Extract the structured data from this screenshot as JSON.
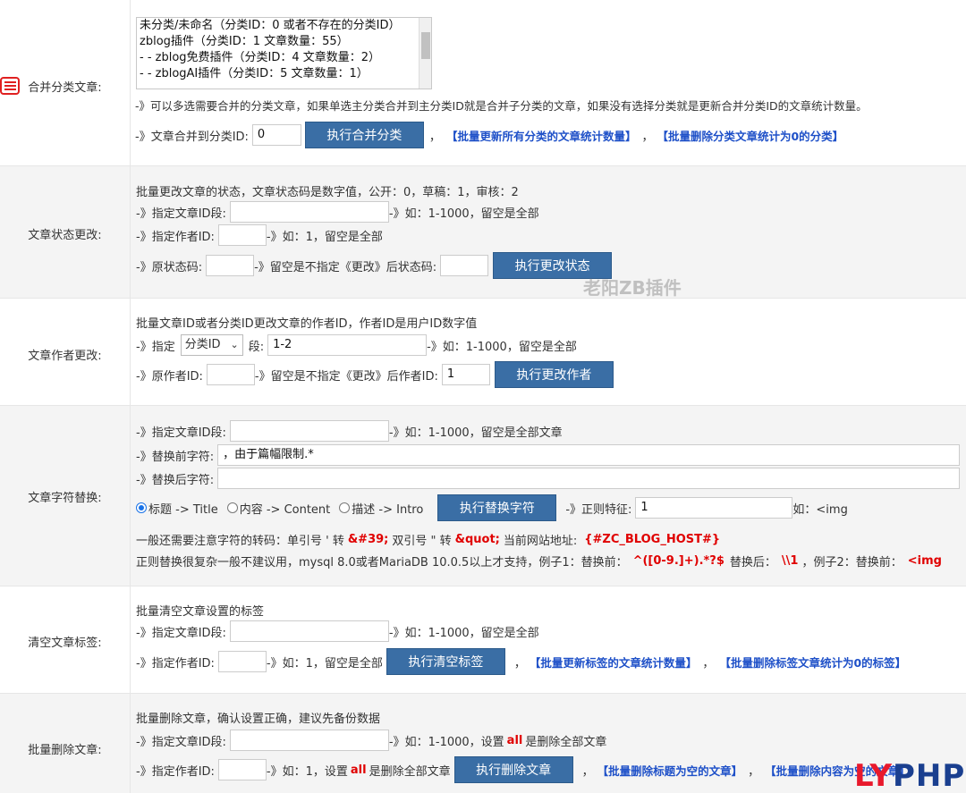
{
  "merge": {
    "label": "合并分类文章:",
    "list": [
      "未分类/未命名（分类ID：0 或者不存在的分类ID）",
      "zblog插件（分类ID：1 文章数量：55）",
      "- - zblog免费插件（分类ID：4 文章数量：2）",
      "- - zblogAI插件（分类ID：5 文章数量：1）"
    ],
    "desc": "-》可以多选需要合并的分类文章，如果单选主分类合并到主分类ID就是合并子分类的文章，如果没有选择分类就是更新合并分类ID的文章统计数量。",
    "target_label": "-》文章合并到分类ID:",
    "target_value": "0",
    "button": "执行合并分类",
    "sep1": "，",
    "link1": "【批量更新所有分类的文章统计数量】",
    "sep2": "，",
    "link2": "【批量删除分类文章统计为0的分类】"
  },
  "status": {
    "label": "文章状态更改:",
    "desc": "批量更改文章的状态，文章状态码是数字值，公开：0，草稿：1，审核：2",
    "id_label": "-》指定文章ID段:",
    "id_hint": "-》如：1-1000，留空是全部",
    "author_label": "-》指定作者ID:",
    "author_hint": "-》如：1，留空是全部",
    "orig_label": "-》原状态码:",
    "orig_hint": "-》留空是不指定《更改》后状态码:",
    "button": "执行更改状态"
  },
  "author": {
    "label": "文章作者更改:",
    "desc": "批量文章ID或者分类ID更改文章的作者ID，作者ID是用户ID数字值",
    "spec_label": "-》指定",
    "select_value": "分类ID",
    "seg_label": "段:",
    "seg_value": "1-2",
    "seg_hint": "-》如：1-1000，留空是全部",
    "orig_label": "-》原作者ID:",
    "orig_hint": "-》留空是不指定《更改》后作者ID:",
    "new_value": "1",
    "button": "执行更改作者"
  },
  "replace": {
    "label": "文章字符替换:",
    "id_label": "-》指定文章ID段:",
    "id_hint": "-》如：1-1000，留空是全部文章",
    "before_label": "-》替换前字符:",
    "before_value": "，由于篇幅限制.*",
    "after_label": "-》替换后字符:",
    "radio1": "标题 -> Title",
    "radio2": "内容 -> Content",
    "radio3": "描述 -> Intro",
    "button": "执行替换字符",
    "regex_label": "-》正则特征:",
    "regex_value": "1",
    "regex_hint": "如：<img",
    "note1_a": "一般还需要注意字符的转码：单引号 ' 转",
    "note1_b": "&#39;",
    "note1_c": "双引号 \" 转",
    "note1_d": "&quot;",
    "note1_e": "当前网站地址:",
    "note1_f": "{#ZC_BLOG_HOST#}",
    "note2_a": "正则替换很复杂一般不建议用，mysql 8.0或者MariaDB 10.0.5以上才支持，例子1：替换前：",
    "note2_b": "^([0-9.]+).*?$",
    "note2_c": "替换后：",
    "note2_d": "\\\\1",
    "note2_e": "，例子2：替换前：",
    "note2_f": "<img"
  },
  "tags": {
    "label": "清空文章标签:",
    "desc": "批量清空文章设置的标签",
    "id_label": "-》指定文章ID段:",
    "id_hint": "-》如：1-1000，留空是全部",
    "author_label": "-》指定作者ID:",
    "author_hint": "-》如：1，留空是全部",
    "button": "执行清空标签",
    "sep1": "，",
    "link1": "【批量更新标签的文章统计数量】",
    "sep2": "，",
    "link2": "【批量删除标签文章统计为0的标签】"
  },
  "delete": {
    "label": "批量删除文章:",
    "desc": "批量删除文章，确认设置正确，建议先备份数据",
    "id_label": "-》指定文章ID段:",
    "id_hint_a": "-》如：1-1000，设置",
    "id_hint_b": "all",
    "id_hint_c": "是删除全部文章",
    "author_label": "-》指定作者ID:",
    "author_hint_a": "-》如：1，设置",
    "author_hint_b": "all",
    "author_hint_c": "是删除全部文章",
    "button": "执行删除文章",
    "sep1": "，",
    "link1": "【批量删除标题为空的文章】",
    "sep2": "，",
    "link2": "【批量删除内容为空的文章】"
  },
  "watermark": {
    "center": "老阳ZB插件",
    "corner_a": "LY",
    "corner_b": "PHP"
  }
}
